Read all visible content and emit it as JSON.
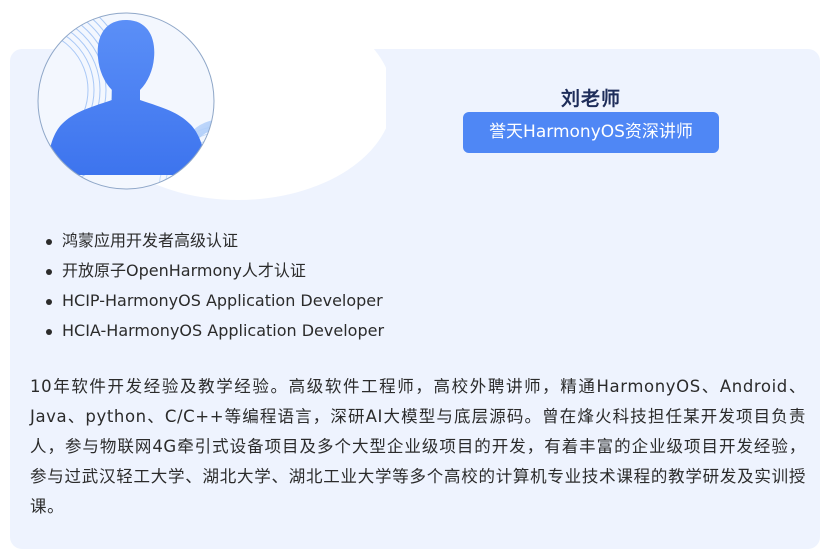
{
  "teacher": {
    "avatar_icon": "person-silhouette-icon",
    "name": "刘老师",
    "title": "誉天HarmonyOS资深讲师"
  },
  "certifications": [
    "鸿蒙应用开发者高级认证",
    "开放原子OpenHarmony人才认证",
    "HCIP-HarmonyOS Application Developer",
    "HCIA-HarmonyOS Application Developer"
  ],
  "bio": "10年软件开发经验及教学经验。高级软件工程师，高校外聘讲师，精通HarmonyOS、Android、Java、python、C/C++等编程语言，深研AI大模型与底层源码。曾在烽火科技担任某开发项目负责人，参与物联网4G牵引式设备项目及多个大型企业级项目的开发，有着丰富的企业级项目开发经验，参与过武汉轻工大学、湖北大学、湖北工业大学等多个高校的计算机专业技术课程的教学研发及实训授课。",
  "colors": {
    "card_background": "#eef3fe",
    "accent": "#4f87f5",
    "name_text": "#1e2d5a",
    "body_text": "#2b2b2b"
  }
}
